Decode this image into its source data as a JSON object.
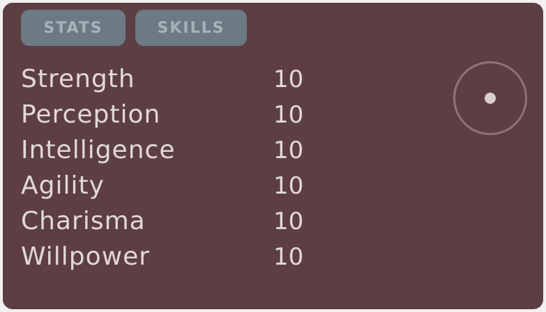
{
  "colors": {
    "panel_bg": "#5d3f43",
    "tab_bg": "#6c7a84",
    "text": "#e2d8d9",
    "orb_ring": "#8e7476",
    "orb_dot": "#d9cfd0"
  },
  "tabs": [
    {
      "label": "STATS",
      "selected": true
    },
    {
      "label": "SKILLS",
      "selected": false
    }
  ],
  "stats": [
    {
      "name": "Strength",
      "value": "10"
    },
    {
      "name": "Perception",
      "value": "10"
    },
    {
      "name": "Intelligence",
      "value": "10"
    },
    {
      "name": "Agility",
      "value": "10"
    },
    {
      "name": "Charisma",
      "value": "10"
    },
    {
      "name": "Willpower",
      "value": "10"
    }
  ],
  "orb": {
    "icon": "orb-icon"
  }
}
